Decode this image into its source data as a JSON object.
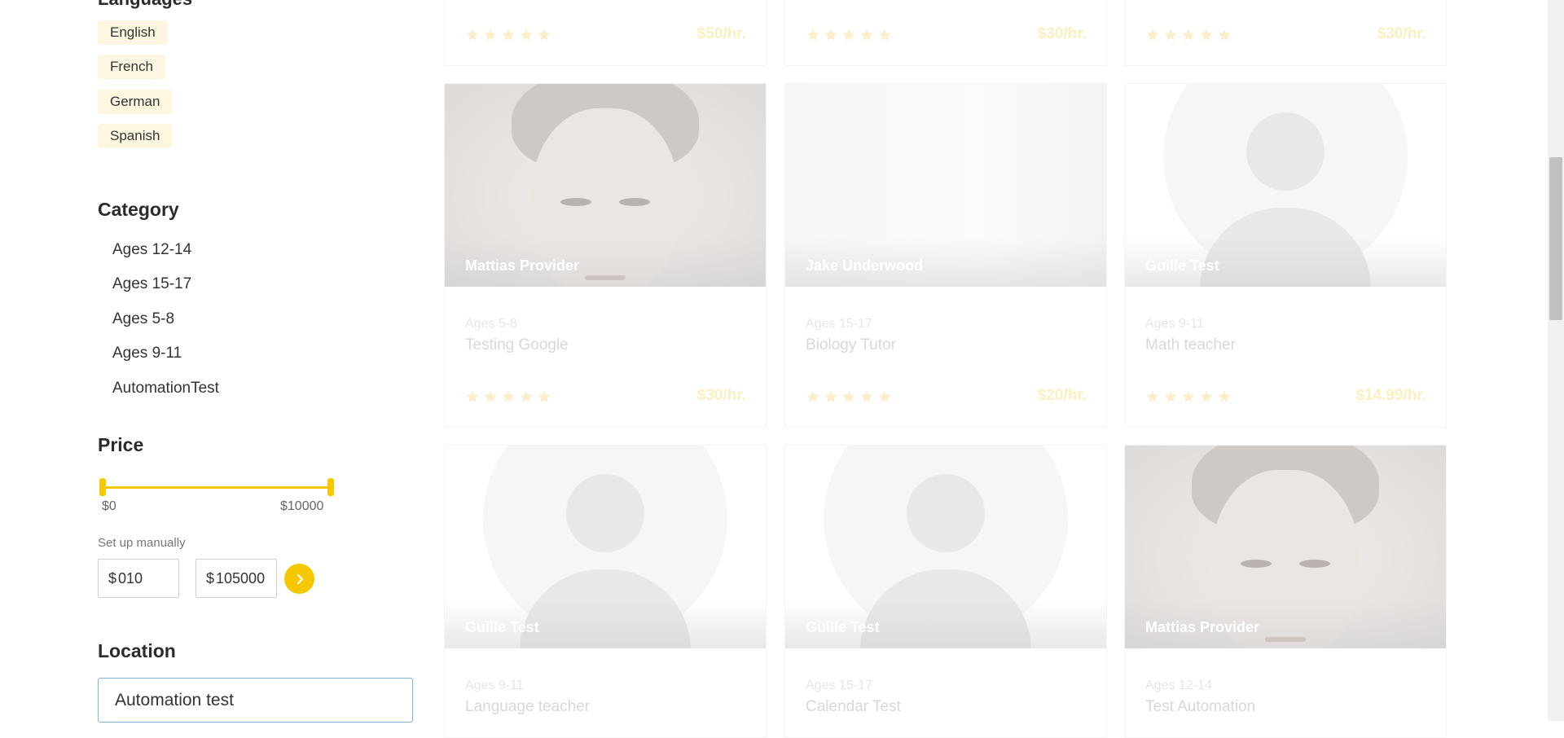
{
  "filters": {
    "languages": [
      "English",
      "French",
      "German",
      "Spanish"
    ],
    "category_title": "Category",
    "categories": [
      "Ages 12-14",
      "Ages 15-17",
      "Ages 5-8",
      "Ages 9-11",
      "AutomationTest"
    ],
    "price_title": "Price",
    "price_slider": {
      "min_label": "$0",
      "max_label": "$10000",
      "min_value": 0,
      "max_value": 10000
    },
    "manual_label": "Set up manually",
    "currency_symbol": "$",
    "manual_min": "010",
    "manual_max": "105000",
    "location_title": "Location",
    "location_value": "Automation test"
  },
  "top_row_prices": [
    "$50/hr.",
    "$30/hr.",
    "$30/hr."
  ],
  "tutors": [
    {
      "name": "Mattias Provider",
      "category": "Ages 5-8",
      "title": "Testing Google",
      "price": "$30/hr."
    },
    {
      "name": "Jake Underwood",
      "category": "Ages 15-17",
      "title": "Biology Tutor",
      "price": "$20/hr."
    },
    {
      "name": "Guille Test",
      "category": "Ages 9-11",
      "title": "Math teacher",
      "price": "$14.99/hr."
    },
    {
      "name": "Guille Test",
      "category": "Ages 9-11",
      "title": "Language teacher"
    },
    {
      "name": "Guille Test",
      "category": "Ages 15-17",
      "title": "Calendar Test"
    },
    {
      "name": "Mattias Provider",
      "category": "Ages 12-14",
      "title": "Test Automation"
    }
  ],
  "colors": {
    "accent": "#f5c800",
    "tag_bg": "#fdf7e1",
    "star_faded": "#fbeecb",
    "price_faded": "#fcefc0"
  },
  "icons": {
    "rating": "star-icon",
    "apply_price": "chevron-right-icon"
  }
}
